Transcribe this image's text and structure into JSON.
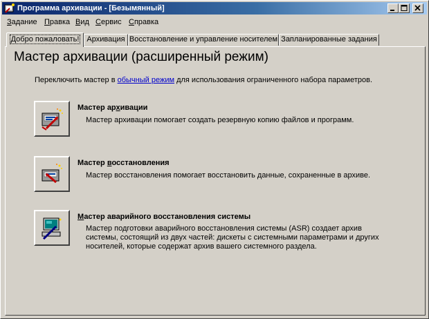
{
  "window": {
    "title": "Программа архивации - [Безымянный]"
  },
  "menu": [
    {
      "pre": "",
      "acc": "З",
      "post": "адание"
    },
    {
      "pre": "",
      "acc": "П",
      "post": "равка"
    },
    {
      "pre": "",
      "acc": "В",
      "post": "ид"
    },
    {
      "pre": "",
      "acc": "С",
      "post": "ервис"
    },
    {
      "pre": "",
      "acc": "С",
      "post": "правка"
    }
  ],
  "tabs": [
    {
      "label": "Добро пожаловать!",
      "active": true
    },
    {
      "label": "Архивация",
      "active": false
    },
    {
      "label": "Восстановление и управление носителем",
      "active": false
    },
    {
      "label": "Запланированные задания",
      "active": false
    }
  ],
  "welcome": {
    "heading": "Мастер архивации (расширенный режим)",
    "intro_before": "Переключить мастер в ",
    "intro_link": "обычный режим",
    "intro_after": " для использования ограниченного набора параметров."
  },
  "wizards": [
    {
      "title_pre": "Мастер ар",
      "title_acc": "х",
      "title_post": "ивации",
      "description": "Мастер архивации помогает создать резервную копию файлов и программ.",
      "icon": "backup-wizard-icon"
    },
    {
      "title_pre": "Мастер ",
      "title_acc": "в",
      "title_post": "осстановления",
      "description": "Мастер восстановления помогает восстановить данные, сохраненные в архиве.",
      "icon": "restore-wizard-icon"
    },
    {
      "title_pre": "",
      "title_acc": "М",
      "title_post": "астер аварийного восстановления системы",
      "description": "Мастер подготовки аварийного восстановления системы (ASR) создает архив системы, состоящий из двух частей: дискеты с системными параметрами и других носителей, которые содержат архив вашего системного раздела.",
      "icon": "asr-wizard-icon"
    }
  ],
  "colors": {
    "face": "#d4d0c8",
    "title_start": "#0a246a",
    "title_end": "#a6caf0",
    "link": "#0000cc"
  }
}
